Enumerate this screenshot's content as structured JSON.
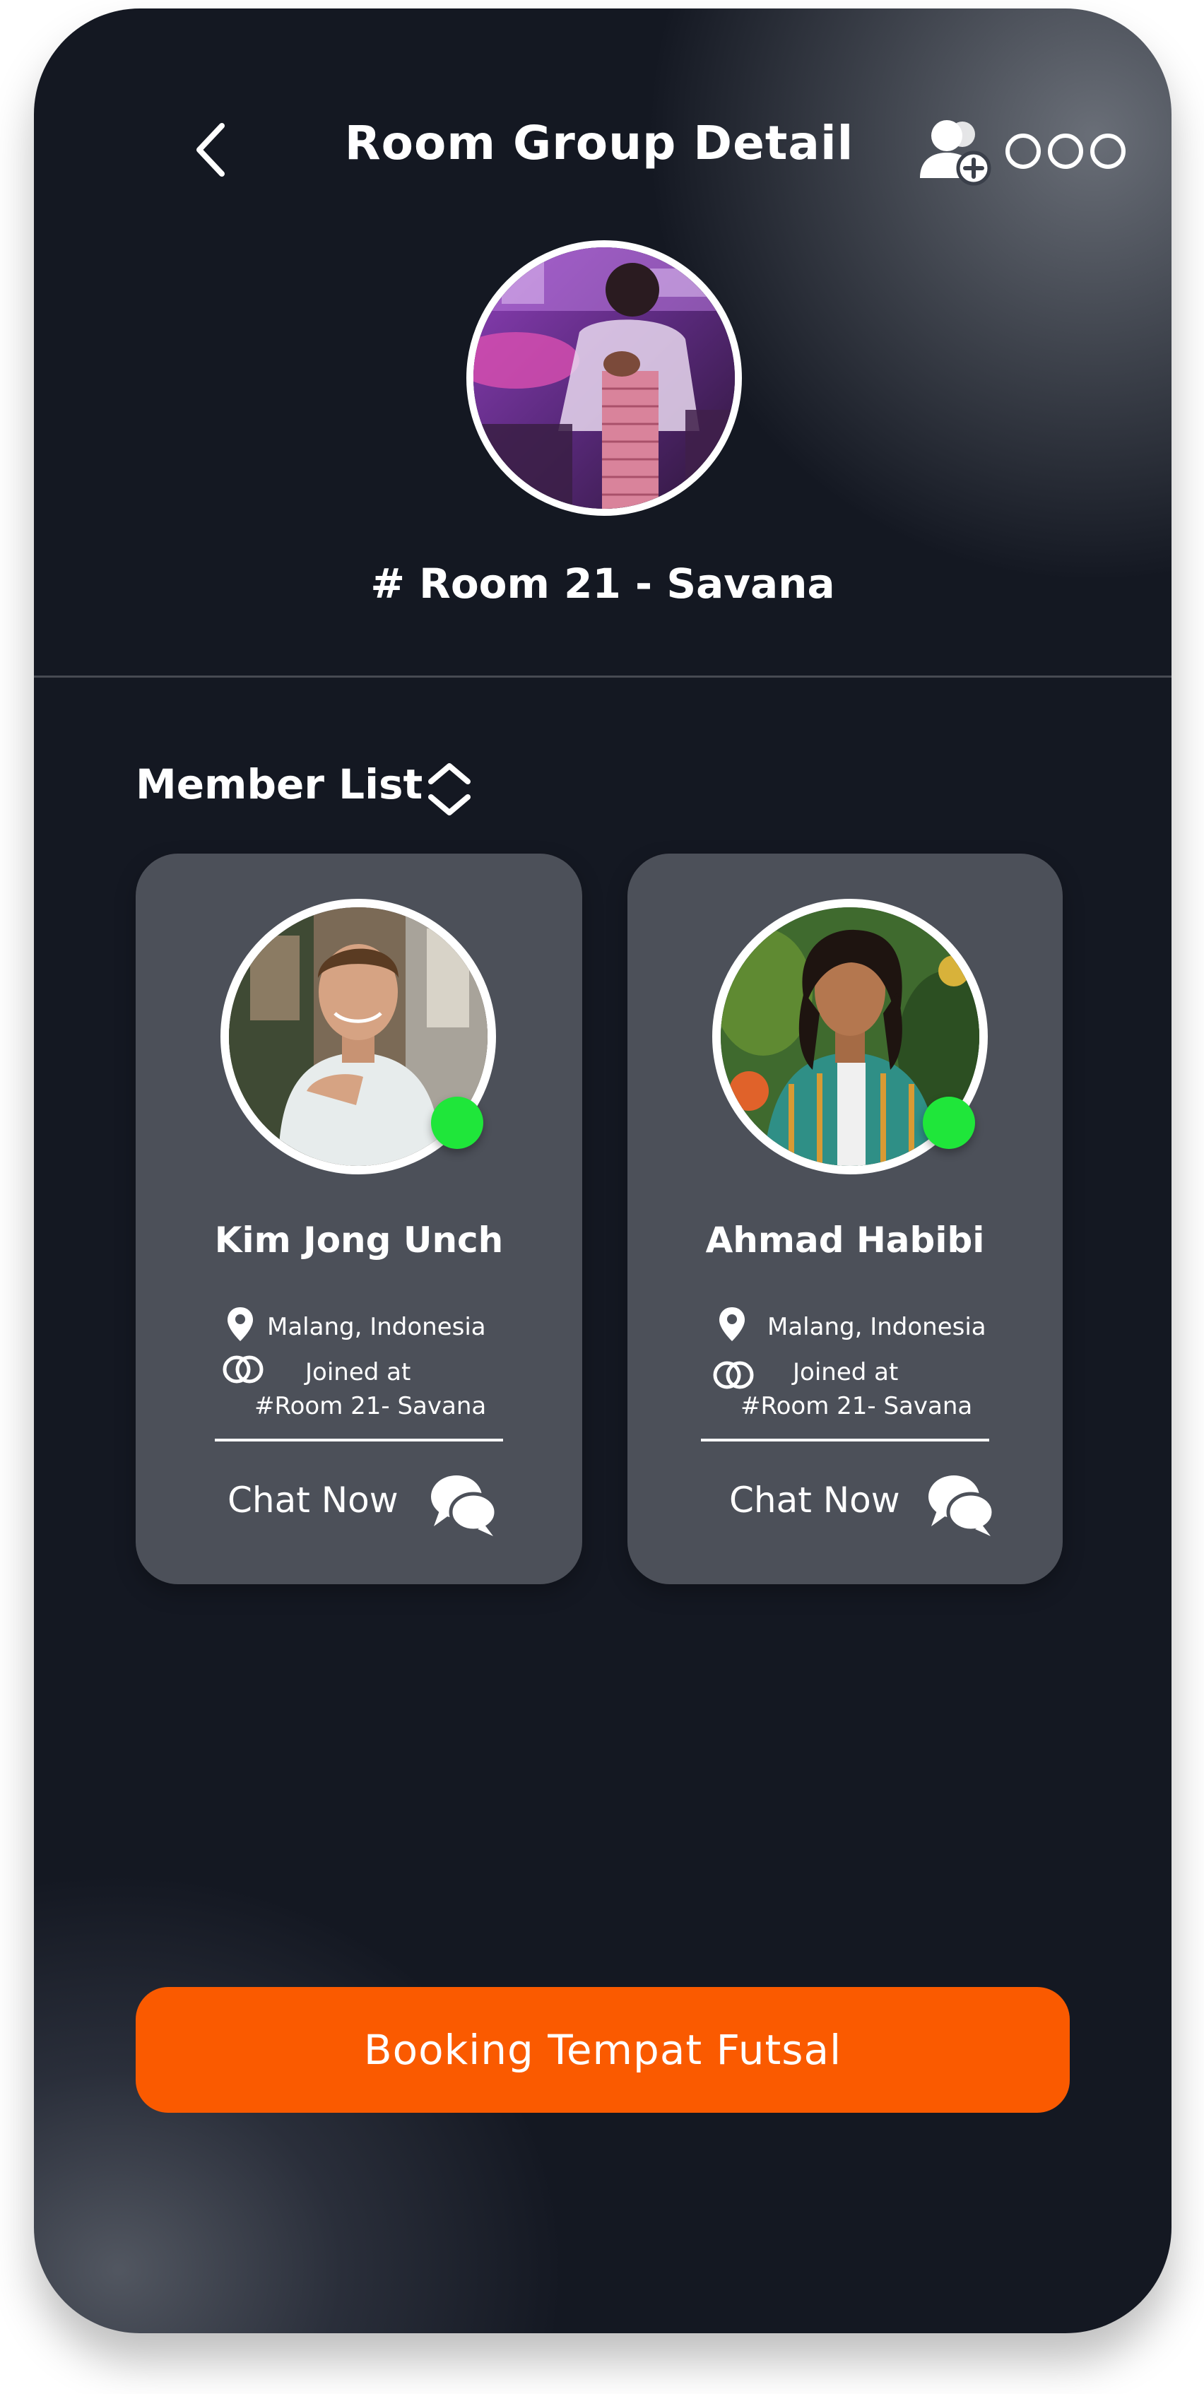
{
  "header": {
    "title": "Room Group Detail",
    "back_icon": "chevron-left-icon",
    "add_member_icon": "add-user-icon",
    "more_icon": "more-options-icon"
  },
  "room": {
    "name": "# Room 21 - Savana",
    "photo": "room-photo"
  },
  "members_section": {
    "title": "Member List",
    "sort_icon": "sort-chevrons-icon"
  },
  "members": [
    {
      "name": "Kim Jong Unch",
      "location": "Malang, Indonesia",
      "joined_label": "Joined at",
      "joined_room": "#Room 21- Savana",
      "status": "online",
      "chat_label": "Chat Now"
    },
    {
      "name": "Ahmad Habibi",
      "location": "Malang, Indonesia",
      "joined_label": "Joined at",
      "joined_room": "#Room 21- Savana",
      "status": "online",
      "chat_label": "Chat Now"
    }
  ],
  "booking": {
    "label": "Booking Tempat Futsal"
  },
  "colors": {
    "accent": "#fa5a00",
    "online": "#1fe63a",
    "card": "#4c5059",
    "background": "#141822"
  }
}
